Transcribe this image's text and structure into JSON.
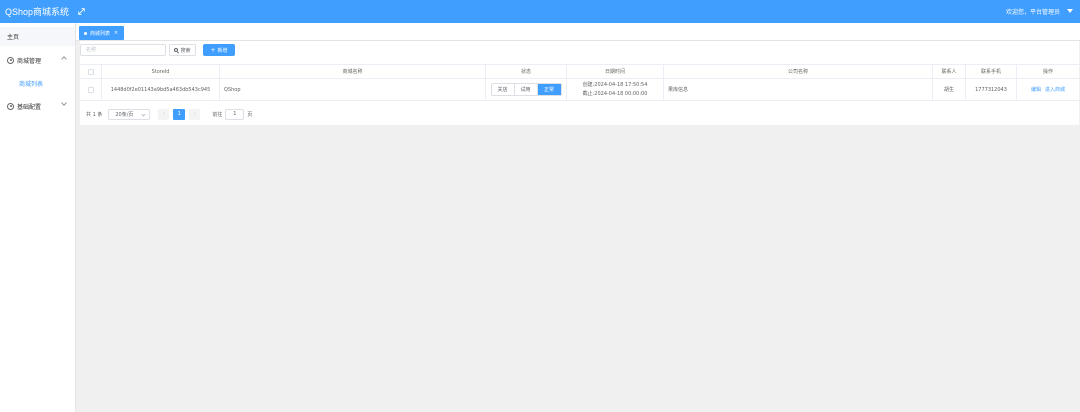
{
  "header": {
    "app_title": "QShop商城系统",
    "welcome": "欢迎您，平台管理员",
    "icons": {
      "expand": "expand-icon",
      "user_dropdown": "caret-down-icon"
    }
  },
  "sidebar": {
    "home": "主页",
    "groups": [
      {
        "label": "商城管理",
        "icon": "settings-circle-icon",
        "expanded": true,
        "items": [
          {
            "label": "商城列表",
            "active": true
          }
        ]
      },
      {
        "label": "基础配置",
        "icon": "settings-circle-icon",
        "expanded": false,
        "items": []
      }
    ]
  },
  "tabs": [
    {
      "label": "商城列表",
      "active": true,
      "close": "×"
    }
  ],
  "toolbar": {
    "search_placeholder": "名称",
    "search_button": "搜索",
    "add_button": "新增",
    "add_prefix": "+"
  },
  "table": {
    "columns": [
      "StoreId",
      "商城名称",
      "状态",
      "日期时间",
      "公司名称",
      "联系人",
      "联系手机",
      "操作"
    ],
    "rows": [
      {
        "store_id": "1448d0f2e01143a9bd5a463db543c945",
        "name": "QShop",
        "status_options": [
          "关店",
          "试用",
          "正常"
        ],
        "status_selected": "正常",
        "created": "创建:2024-04-18 17:50:54",
        "expires": "截止:2024-04-18 00:00:00",
        "company": "果库信息",
        "contact": "胡生",
        "phone": "1777312043",
        "actions": [
          "编辑",
          "进入商城"
        ]
      }
    ]
  },
  "pagination": {
    "total_label": "共 1 条",
    "page_size": "20条/页",
    "prev": "‹",
    "next": "›",
    "current_page": "1",
    "goto_prefix": "前往",
    "goto_value": "1",
    "goto_suffix": "页"
  },
  "colors": {
    "primary": "#409eff",
    "background": "#f0f0f0"
  }
}
